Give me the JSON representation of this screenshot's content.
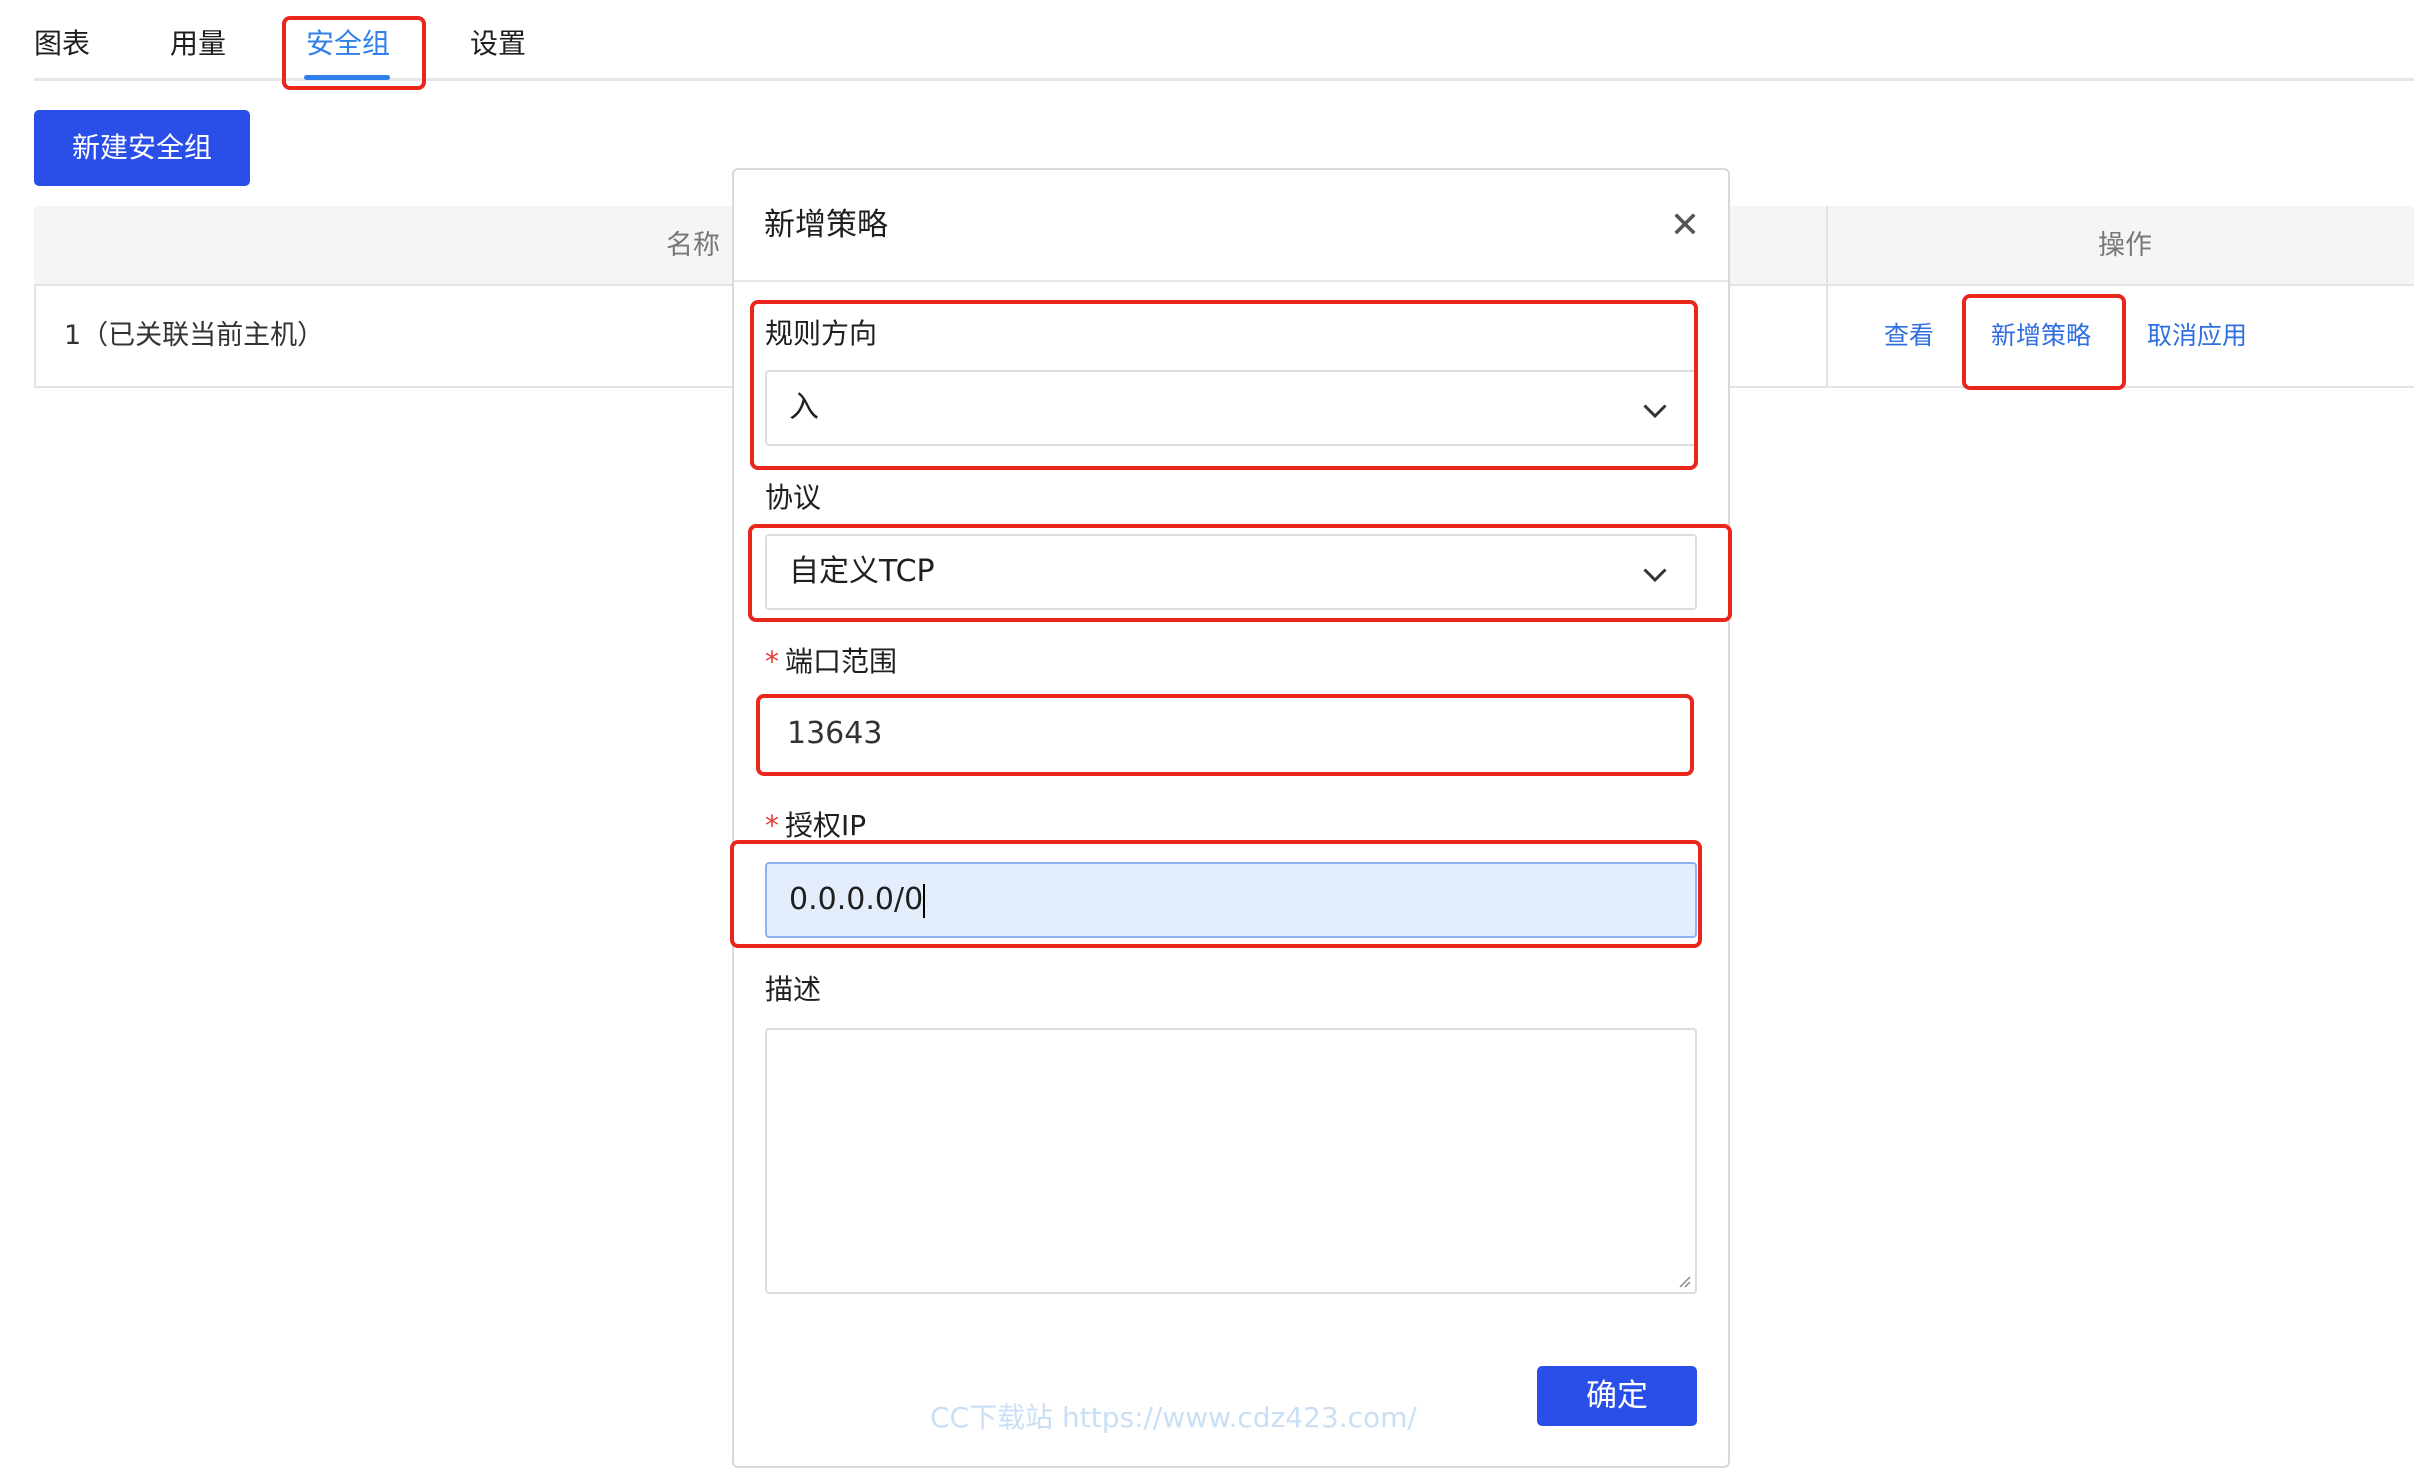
{
  "tabs": [
    {
      "label": "图表"
    },
    {
      "label": "用量"
    },
    {
      "label": "安全组",
      "active": true
    },
    {
      "label": "设置"
    }
  ],
  "toolbar": {
    "new_group_label": "新建安全组"
  },
  "table": {
    "headers": {
      "name": "名称",
      "actions": "操作"
    },
    "rows": [
      {
        "name": "1（已关联当前主机）",
        "actions": [
          "查看",
          "新增策略",
          "取消应用"
        ]
      }
    ]
  },
  "dialog": {
    "title": "新增策略",
    "close_icon": "close-icon",
    "fields": {
      "direction": {
        "label": "规则方向",
        "value": "入"
      },
      "protocol": {
        "label": "协议",
        "value": "自定义TCP"
      },
      "port_range": {
        "label": "端口范围",
        "value": "13643",
        "required": true
      },
      "auth_ip": {
        "label": "授权IP",
        "value": "0.0.0.0/0",
        "required": true
      },
      "description": {
        "label": "描述",
        "value": ""
      }
    },
    "confirm_label": "确定"
  },
  "watermark": "CC下载站 https://www.cdz423.com/",
  "colors": {
    "accent": "#2f80ed",
    "primary_button": "#2a4ee8",
    "highlight": "#e8261c",
    "required": "#e53935",
    "focused_field": "#e3edfc"
  }
}
